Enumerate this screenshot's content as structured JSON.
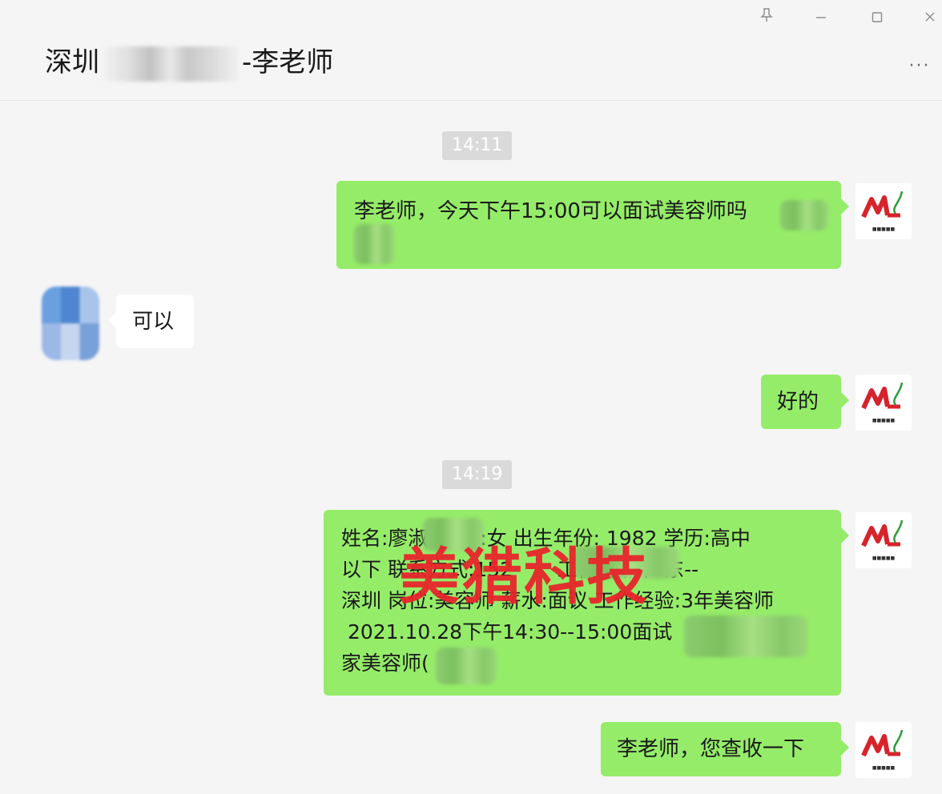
{
  "window": {
    "pin_icon": "pin-icon",
    "minimize_icon": "minimize-icon",
    "maximize_icon": "maximize-icon",
    "close_icon": "close-icon"
  },
  "header": {
    "title_prefix": "深圳",
    "title_suffix": "-李老师",
    "more_label": "···"
  },
  "messages": [
    {
      "type": "time",
      "text": "14:11"
    },
    {
      "type": "sent",
      "text": "李老师，今天下午15:00可以面试美容师吗"
    },
    {
      "type": "received",
      "text": "可以"
    },
    {
      "type": "sent",
      "text": "好的"
    },
    {
      "type": "time",
      "text": "14:19"
    },
    {
      "type": "sent",
      "lines": [
        "姓名:廖淑     别:女 出生年份: 1982 学历:高中",
        "以下 联系方式:152       工作地点:广东--",
        "深圳 岗位:美容师 薪水:面议 工作经验:3年美容师",
        " 2021.10.28下午14:30--15:00面试",
        "家美容师("
      ]
    },
    {
      "type": "sent",
      "text": "李老师，您查收一下"
    }
  ],
  "avatar_logo": {
    "letters": "ML",
    "brand_color": "#d7232b",
    "accent_color": "#2e9b3c"
  },
  "watermark": "美猎科技",
  "colors": {
    "sent_bubble": "#95ec69",
    "received_bubble": "#ffffff",
    "background": "#f5f5f5"
  }
}
